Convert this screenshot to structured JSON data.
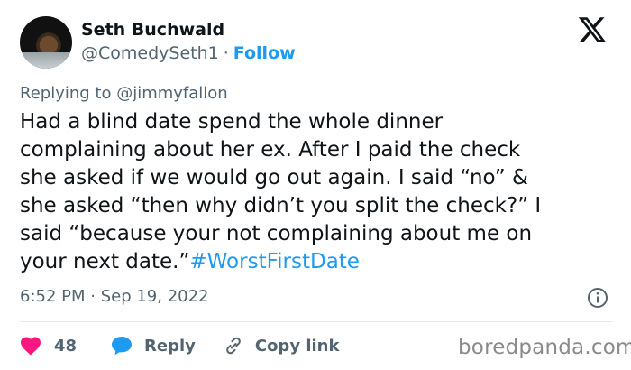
{
  "author": {
    "display_name": "Seth Buchwald",
    "handle": "@ComedySeth1",
    "separator": "·",
    "follow_label": "Follow"
  },
  "reply_context": "Replying to @jimmyfallon",
  "tweet": {
    "text": "Had a blind date spend the whole dinner\ncomplaining about her ex. After I paid the check\nshe asked if we would go out again. I said “no” &\nshe asked “then why didn’t you split the check?” I\nsaid “because your not complaining about me on\nyour next date.”",
    "hashtag": "#WorstFirstDate"
  },
  "timestamp": "6:52 PM · Sep 19, 2022",
  "actions": {
    "like_count": "48",
    "reply_label": "Reply",
    "copy_link_label": "Copy link"
  },
  "watermark": "boredpanda.com",
  "colors": {
    "link_blue": "#1d9bf0",
    "like_pink": "#f91880",
    "text_primary": "#0f1419",
    "text_secondary": "#536471"
  },
  "icons": [
    "x-logo-icon",
    "info-icon",
    "heart-icon",
    "reply-bubble-icon",
    "link-icon"
  ]
}
